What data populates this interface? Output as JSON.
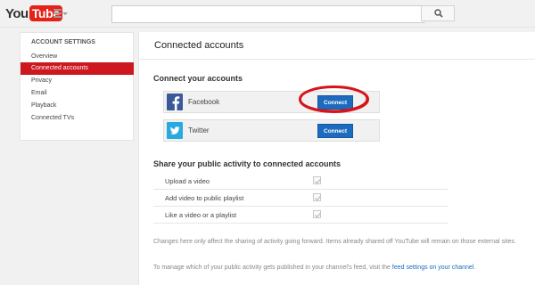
{
  "masthead": {
    "logo_you": "You",
    "logo_tube": "Tube",
    "search_placeholder": ""
  },
  "sidebar": {
    "heading": "ACCOUNT SETTINGS",
    "items": [
      {
        "label": "Overview"
      },
      {
        "label": "Connected accounts"
      },
      {
        "label": "Privacy"
      },
      {
        "label": "Email"
      },
      {
        "label": "Playback"
      },
      {
        "label": "Connected TVs"
      }
    ]
  },
  "main": {
    "title": "Connected accounts",
    "connect_section_title": "Connect your accounts",
    "accounts": [
      {
        "name": "Facebook",
        "button": "Connect",
        "color": "#3b5998",
        "icon": "facebook-icon"
      },
      {
        "name": "Twitter",
        "button": "Connect",
        "color": "#2aa9e0",
        "icon": "twitter-icon"
      }
    ],
    "share_section_title": "Share your public activity to connected accounts",
    "share_options": [
      {
        "label": "Upload a video",
        "checked": true
      },
      {
        "label": "Add video to public playlist",
        "checked": true
      },
      {
        "label": "Like a video or a playlist",
        "checked": true
      }
    ],
    "note_1": "Changes here only affect the sharing of activity going forward. Items already shared off YouTube will remain on those external sites.",
    "note_2_prefix": "To manage which of your public activity gets published in your channel's feed, visit the",
    "note_2_link": "feed settings on your channel",
    "note_2_suffix": "."
  },
  "colors": {
    "accent_red": "#cc181e",
    "connect_blue": "#1c6bbf",
    "highlight_ring": "#d7141a"
  }
}
